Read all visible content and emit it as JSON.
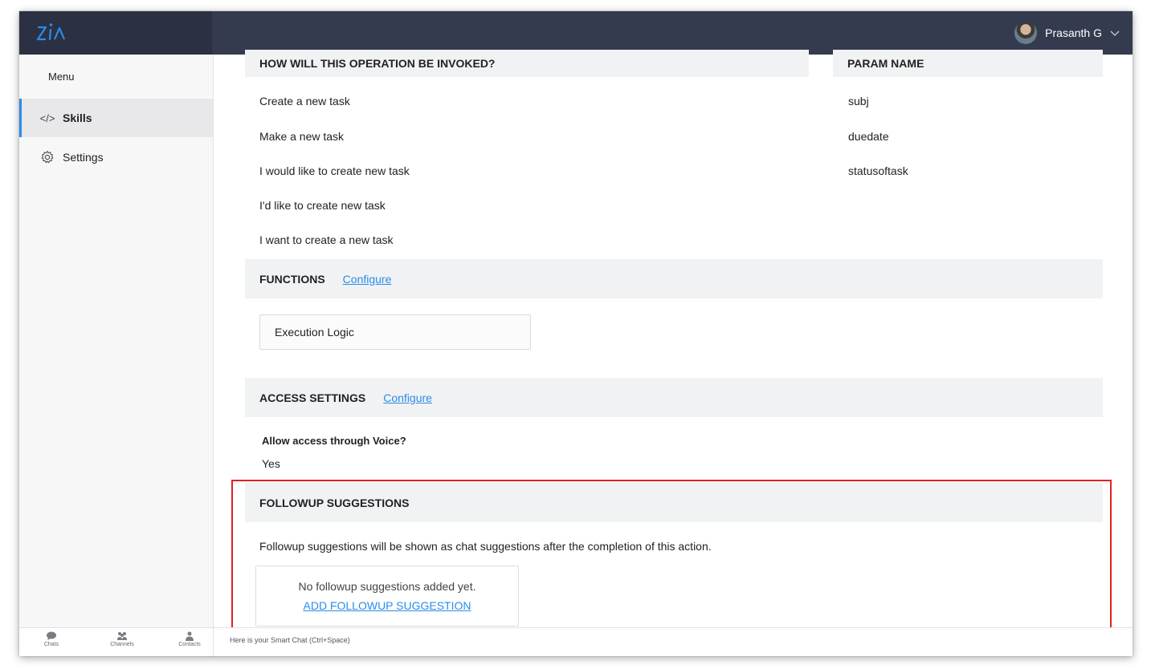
{
  "app": {
    "user_name": "Prasanth G"
  },
  "sidebar": {
    "menu_title": "Menu",
    "items": [
      {
        "label": "Skills",
        "icon": "code-icon",
        "active": true
      },
      {
        "label": "Settings",
        "icon": "gear-icon",
        "active": false
      }
    ]
  },
  "main": {
    "invocation_header": "HOW WILL THIS OPERATION BE INVOKED?",
    "invocations": [
      "Create a new task",
      "Make a new task",
      "I would like to create new task",
      "I'd like to create new task",
      "I want to create a new task"
    ],
    "param_header": "PARAM NAME",
    "params": [
      "subj",
      "duedate",
      "statusoftask"
    ],
    "functions": {
      "title": "FUNCTIONS",
      "configure_label": "Configure",
      "item": "Execution Logic"
    },
    "access": {
      "title": "ACCESS SETTINGS",
      "configure_label": "Configure",
      "question": "Allow access through Voice?",
      "answer": "Yes"
    },
    "followup": {
      "title": "FOLLOWUP SUGGESTIONS",
      "description": "Followup suggestions will be shown as chat suggestions after the completion of this action.",
      "empty_text": "No followup suggestions added yet.",
      "add_label": "ADD FOLLOWUP SUGGESTION"
    }
  },
  "bottombar": {
    "tabs": [
      {
        "label": "Chats",
        "icon": "chat-icon"
      },
      {
        "label": "Channels",
        "icon": "channels-icon"
      },
      {
        "label": "Contacts",
        "icon": "contacts-icon"
      }
    ],
    "smartchat_placeholder": "Here is your Smart Chat (Ctrl+Space)"
  },
  "colors": {
    "topbar": "#343b4f",
    "accent": "#2a8ce8",
    "highlight": "#e52020",
    "section_bg": "#f1f2f4"
  }
}
